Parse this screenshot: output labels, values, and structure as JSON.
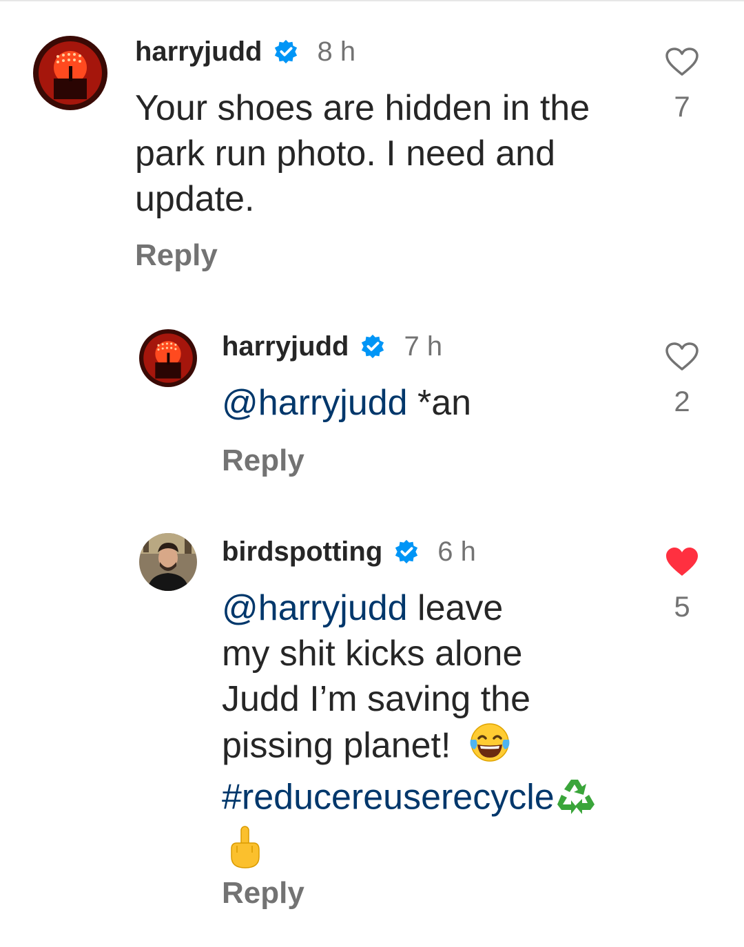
{
  "comments": [
    {
      "username": "harryjudd",
      "time": "8 h",
      "text": "Your shoes are hidden in the park run photo. I need and update.",
      "lines": [
        "Your shoes are hidden in the",
        "park run photo. I need and",
        "update."
      ],
      "likes": "7",
      "liked": false,
      "reply_label": "Reply",
      "avatar_icon": "concert-stage-avatar"
    },
    {
      "username": "harryjudd",
      "time": "7 h",
      "mention": "@harryjudd",
      "text_after": " *an",
      "likes": "2",
      "liked": false,
      "reply_label": "Reply",
      "avatar_icon": "concert-stage-avatar"
    },
    {
      "username": "birdspotting",
      "time": "6 h",
      "mention": "@harryjudd",
      "line1_after": " leave",
      "line2": "my shit kicks alone",
      "line3": "Judd I’m saving the",
      "line4": "pissing planet!",
      "hashtag": "#reducereuserecycle",
      "likes": "5",
      "liked": true,
      "reply_label": "Reply",
      "avatar_icon": "man-portrait-avatar"
    }
  ],
  "colors": {
    "verified": "#0095f6",
    "mention": "#00376b",
    "like_active": "#ff3040",
    "muted": "#737373"
  },
  "icons": [
    "verified-badge-icon",
    "heart-outline-icon",
    "heart-filled-icon",
    "tears-of-joy-emoji",
    "recycle-emoji",
    "middle-finger-emoji"
  ]
}
